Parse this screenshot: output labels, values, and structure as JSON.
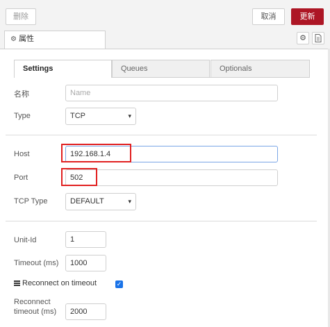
{
  "toolbar": {
    "delete_label": "删除",
    "cancel_label": "取消",
    "update_label": "更新"
  },
  "panel_tab": {
    "label": "属性",
    "icon": "gear-icon"
  },
  "panel_icons": [
    "gear-icon",
    "document-icon"
  ],
  "subtabs": [
    "Settings",
    "Queues",
    "Optionals"
  ],
  "fields": {
    "name": {
      "label": "名称",
      "placeholder": "Name",
      "value": ""
    },
    "type": {
      "label": "Type",
      "value": "TCP"
    },
    "host": {
      "label": "Host",
      "value": "192.168.1.4"
    },
    "port": {
      "label": "Port",
      "value": "502"
    },
    "tcp_type": {
      "label": "TCP Type",
      "value": "DEFAULT"
    },
    "unit_id": {
      "label": "Unit-Id",
      "value": "1"
    },
    "timeout": {
      "label": "Timeout (ms)",
      "value": "1000"
    },
    "reconnect_on_timeout": {
      "label": "Reconnect on timeout",
      "checked": true
    },
    "reconnect_timeout": {
      "label_line1": "Reconnect",
      "label_line2": "timeout (ms)",
      "value": "2000"
    }
  },
  "colors": {
    "accent_update": "#ad1625",
    "highlight_box": "#e11f1f",
    "checkbox": "#1a73e8"
  }
}
